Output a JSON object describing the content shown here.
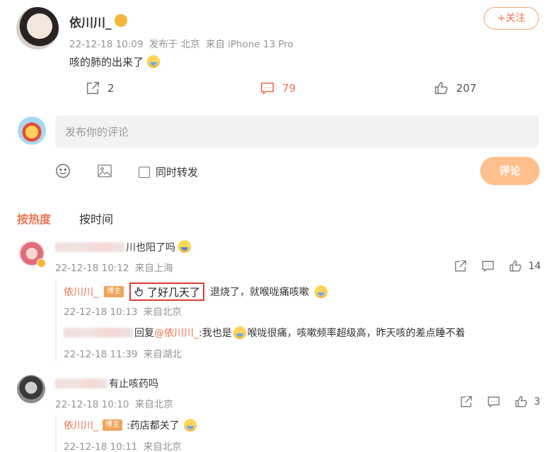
{
  "post": {
    "author": "依川川_",
    "date": "22-12-18 10:09",
    "location": "发布于 北京",
    "device": "来自 iPhone 13 Pro",
    "text": "咳的肺的出来了",
    "follow_label": "+关注",
    "share_count": "2",
    "comment_count": "79",
    "like_count": "207"
  },
  "composer": {
    "placeholder": "发布你的评论",
    "repost_label": "同时转发",
    "submit_label": "评论"
  },
  "sort": {
    "hot": "按热度",
    "time": "按时间"
  },
  "comments": [
    {
      "text": "川也阳了吗",
      "date": "22-12-18 10:12",
      "location": "来自上海",
      "like_count": "14",
      "replies": [
        {
          "author": "依川川_",
          "badge": "博主",
          "quote": "了好几天了",
          "text": "退烧了，就喉咙痛咳嗽",
          "date": "22-12-18 10:13",
          "location": "来自北京"
        },
        {
          "prefix": "回复",
          "mention": "@依川川_",
          "text_a": ":我也是",
          "text_b": "喉咙很痛，咳嗽频率超级高，昨天咳的差点睡不着",
          "date": "22-12-18 11:39",
          "location": "来自湖北"
        }
      ]
    },
    {
      "text": "有止咳药吗",
      "date": "22-12-18 10:10",
      "location": "来自北京",
      "like_count": "3",
      "replies": [
        {
          "author": "依川川_",
          "badge": "博主",
          "text": ":药店都关了",
          "date": "22-12-18 10:11",
          "location": "来自北京"
        }
      ]
    }
  ],
  "colors": {
    "accent": "#eb7350",
    "submit_bg": "#ffc08e",
    "follow_border": "#f0a270",
    "highlight_box": "#e03a2f"
  }
}
